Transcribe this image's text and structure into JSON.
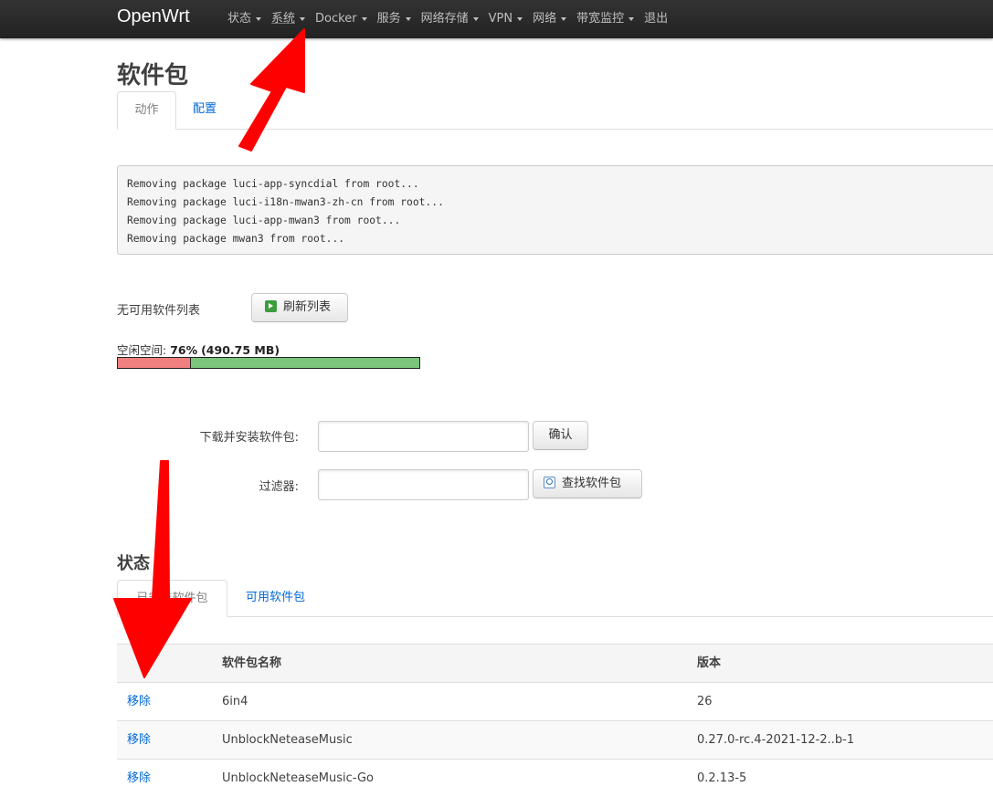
{
  "brand": "OpenWrt",
  "nav": [
    {
      "label": "状态"
    },
    {
      "label": "系统"
    },
    {
      "label": "Docker"
    },
    {
      "label": "服务"
    },
    {
      "label": "网络存储"
    },
    {
      "label": "VPN"
    },
    {
      "label": "网络"
    },
    {
      "label": "带宽监控"
    },
    {
      "label": "退出"
    }
  ],
  "page_title": "软件包",
  "top_tabs": [
    {
      "label": "动作"
    },
    {
      "label": "配置"
    }
  ],
  "log_lines": [
    "Removing package luci-app-syncdial from root...",
    "Removing package luci-i18n-mwan3-zh-cn from root...",
    "Removing package luci-app-mwan3 from root...",
    "Removing package mwan3 from root..."
  ],
  "no_list_text": "无可用软件列表",
  "refresh_button": "刷新列表",
  "storage": {
    "label": "空闲空间: ",
    "percent": "76%",
    "size": "(490.75 MB)",
    "free_fraction": 0.76,
    "used_color": "#f08080",
    "free_color": "#7bc47b"
  },
  "download": {
    "label": "下载并安装软件包:",
    "value": "",
    "button": "确认"
  },
  "filter": {
    "label": "过滤器:",
    "value": "",
    "button": "查找软件包"
  },
  "status_title": "状态",
  "status_tabs": [
    {
      "label": "已安装软件包"
    },
    {
      "label": "可用软件包"
    }
  ],
  "table": {
    "headers": [
      "",
      "软件包名称",
      "版本"
    ],
    "rows": [
      {
        "action": "移除",
        "name": "6in4",
        "version": "26"
      },
      {
        "action": "移除",
        "name": "UnblockNeteaseMusic",
        "version": "0.27.0-rc.4-2021-12-2..b-1"
      },
      {
        "action": "移除",
        "name": "UnblockNeteaseMusic-Go",
        "version": "0.2.13-5"
      }
    ]
  },
  "colors": {
    "navbar": "#222222",
    "link": "#0069d6",
    "annotation_arrow": "#ff0000"
  }
}
